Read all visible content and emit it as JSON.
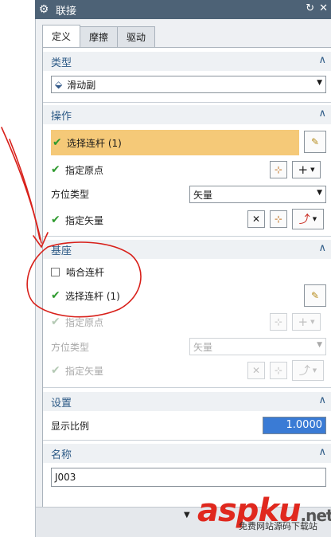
{
  "window": {
    "title": "联接"
  },
  "tabs": [
    {
      "label": "定义"
    },
    {
      "label": "摩擦"
    },
    {
      "label": "驱动"
    }
  ],
  "sections": {
    "type": {
      "header": "类型",
      "select_value": "滑动副"
    },
    "action": {
      "header": "操作",
      "select_link": "选择连杆 (1)",
      "origin": "指定原点",
      "orient_label": "方位类型",
      "orient_value": "矢量",
      "vector": "指定矢量"
    },
    "base": {
      "header": "基座",
      "snap_label": "啮合连杆",
      "select_link": "选择连杆 (1)",
      "origin": "指定原点",
      "orient_label": "方位类型",
      "orient_value": "矢量",
      "vector": "指定矢量"
    },
    "settings": {
      "header": "设置",
      "scale_label": "显示比例",
      "scale_value": "1.0000"
    },
    "name": {
      "header": "名称",
      "value": "J003"
    }
  },
  "footer": {
    "more": "▼"
  },
  "watermark": {
    "text": "aspku",
    "net": ".net",
    "sub": "免费网站源码下载站"
  },
  "colors": {
    "titlebar": "#4d6276",
    "section_text": "#2d5a86",
    "highlight": "#f5c978",
    "check": "#2e9a2e",
    "annotation": "#d8201a"
  }
}
